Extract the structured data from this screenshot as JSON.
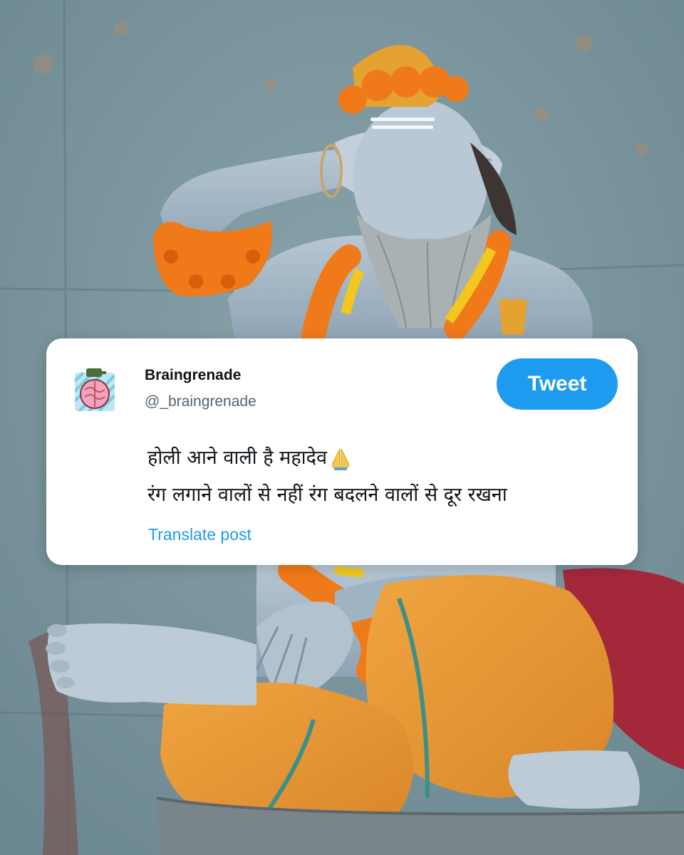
{
  "background": {
    "description_icon": "sadhu-photo",
    "colors": {
      "wall": "#7f98a1",
      "marigold": "#f07a1a",
      "robe": "#e89a2c",
      "cloth": "#a3283a"
    }
  },
  "tweet": {
    "display_name": "Braingrenade",
    "handle": "@_braingrenade",
    "button_label": "Tweet",
    "lines": [
      "होली आने वाली है महादेव",
      "रंग लगाने वालों से नहीं रंग बदलने वालों से दूर रखना"
    ],
    "emoji_icon": "folded-hands-icon",
    "translate_label": "Translate post",
    "accent_color": "#1d9bf0"
  }
}
